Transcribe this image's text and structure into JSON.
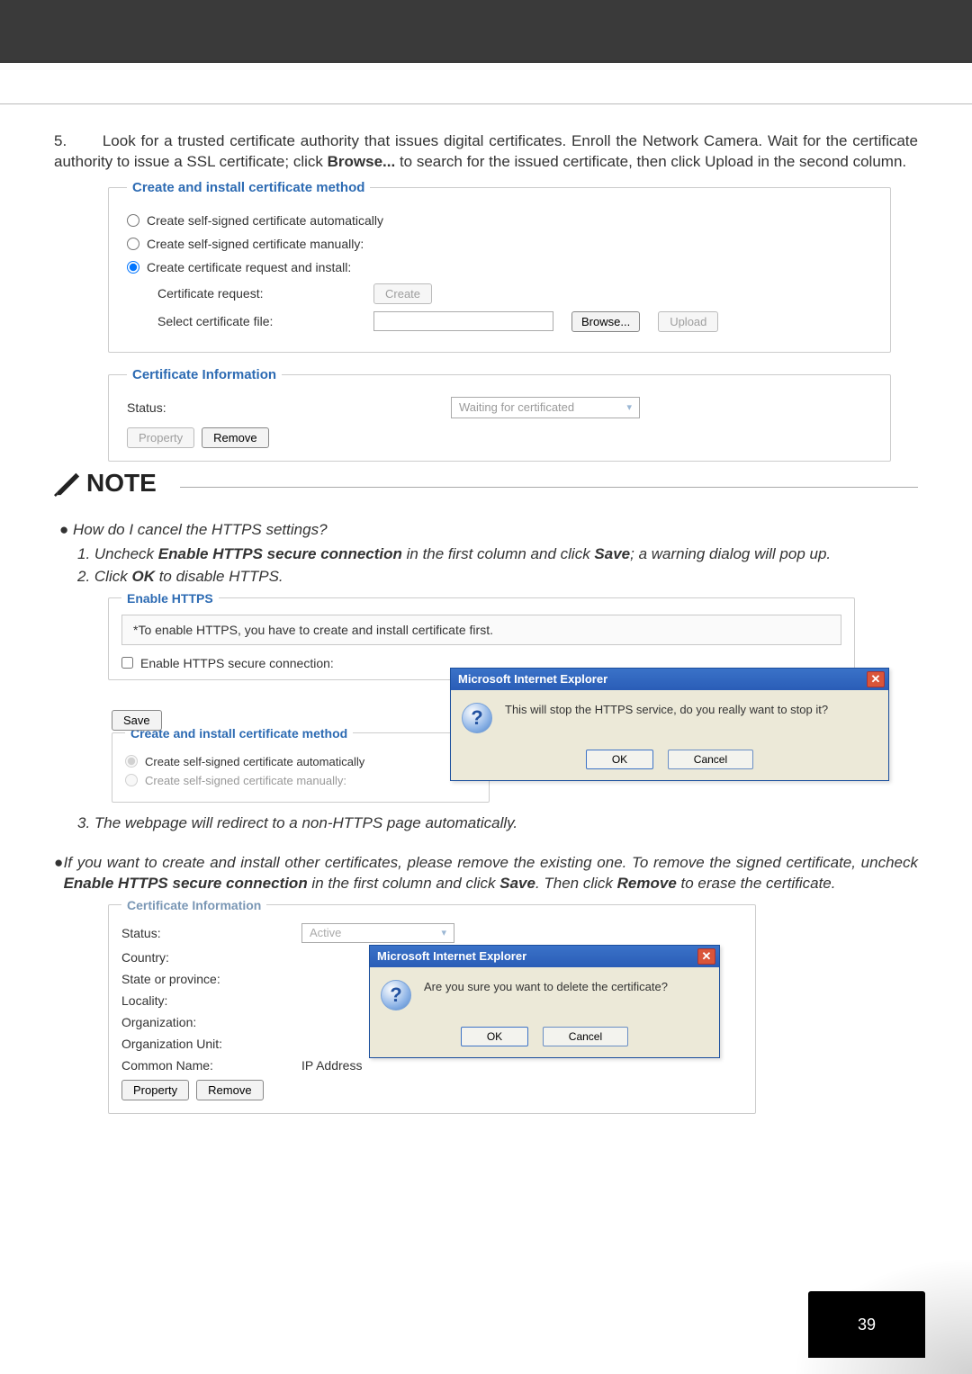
{
  "page_number": "39",
  "step5": {
    "num": "5.",
    "text_a": "Look for a trusted certificate authority that issues digital certificates. Enroll the Network Camera. Wait for the certificate authority to issue a SSL certificate; click ",
    "browse_bold": "Browse...",
    "text_b": " to search for the issued certificate, then click Upload in the second column."
  },
  "panel1": {
    "legend": "Create and install certificate method",
    "opt_auto": "Create self-signed certificate automatically",
    "opt_manual": "Create self-signed certificate manually:",
    "opt_request": "Create certificate request and install:",
    "sub_request_label": "Certificate request:",
    "create_btn": "Create",
    "sub_file_label": "Select certificate file:",
    "browse_btn": "Browse...",
    "upload_btn": "Upload"
  },
  "panel1b": {
    "legend": "Certificate Information",
    "status_label": "Status:",
    "status_value": "Waiting for certificated",
    "property_btn": "Property",
    "remove_btn": "Remove"
  },
  "note_label": "NOTE",
  "note": {
    "q": "How do I cancel the HTTPS settings?",
    "l1a": "1. Uncheck ",
    "l1b": "Enable HTTPS secure connection",
    "l1c": " in the first column and click ",
    "l1d": "Save",
    "l1e": "; a warning dialog will pop up.",
    "l2a": "2. Click ",
    "l2b": "OK",
    "l2c": " to disable HTTPS."
  },
  "shot2": {
    "legend": "Enable HTTPS",
    "hint": "*To enable HTTPS, you have to create and install certificate first.",
    "chk_label": "Enable HTTPS secure connection:",
    "save_btn": "Save",
    "legend2": "Create and install certificate method",
    "r1": "Create self-signed certificate automatically",
    "r2": "Create self-signed certificate manually:",
    "dlg_title": "Microsoft Internet Explorer",
    "dlg_msg": "This will stop the HTTPS service, do you really want to stop it?",
    "ok": "OK",
    "cancel": "Cancel"
  },
  "after2": "3. The webpage will redirect to a non-HTTPS page automatically.",
  "para2": {
    "a": "If you want to create and install other certificates, please remove the existing one. To remove the signed certificate, uncheck ",
    "b": "Enable HTTPS secure connection",
    "c": " in the first column and click ",
    "d": "Save",
    "e": ". Then click ",
    "f": "Remove",
    "g": " to erase the certificate."
  },
  "shot3": {
    "legend": "Certificate Information",
    "rows": {
      "status": "Status:",
      "status_val": "Active",
      "country": "Country:",
      "state": "State or province:",
      "locality": "Locality:",
      "org": "Organization:",
      "orgunit": "Organization Unit:",
      "cn": "Common Name:",
      "cn_val": "IP Address"
    },
    "property_btn": "Property",
    "remove_btn": "Remove",
    "dlg_title": "Microsoft Internet Explorer",
    "dlg_msg": "Are you sure you want to delete the certificate?",
    "ok": "OK",
    "cancel": "Cancel"
  }
}
